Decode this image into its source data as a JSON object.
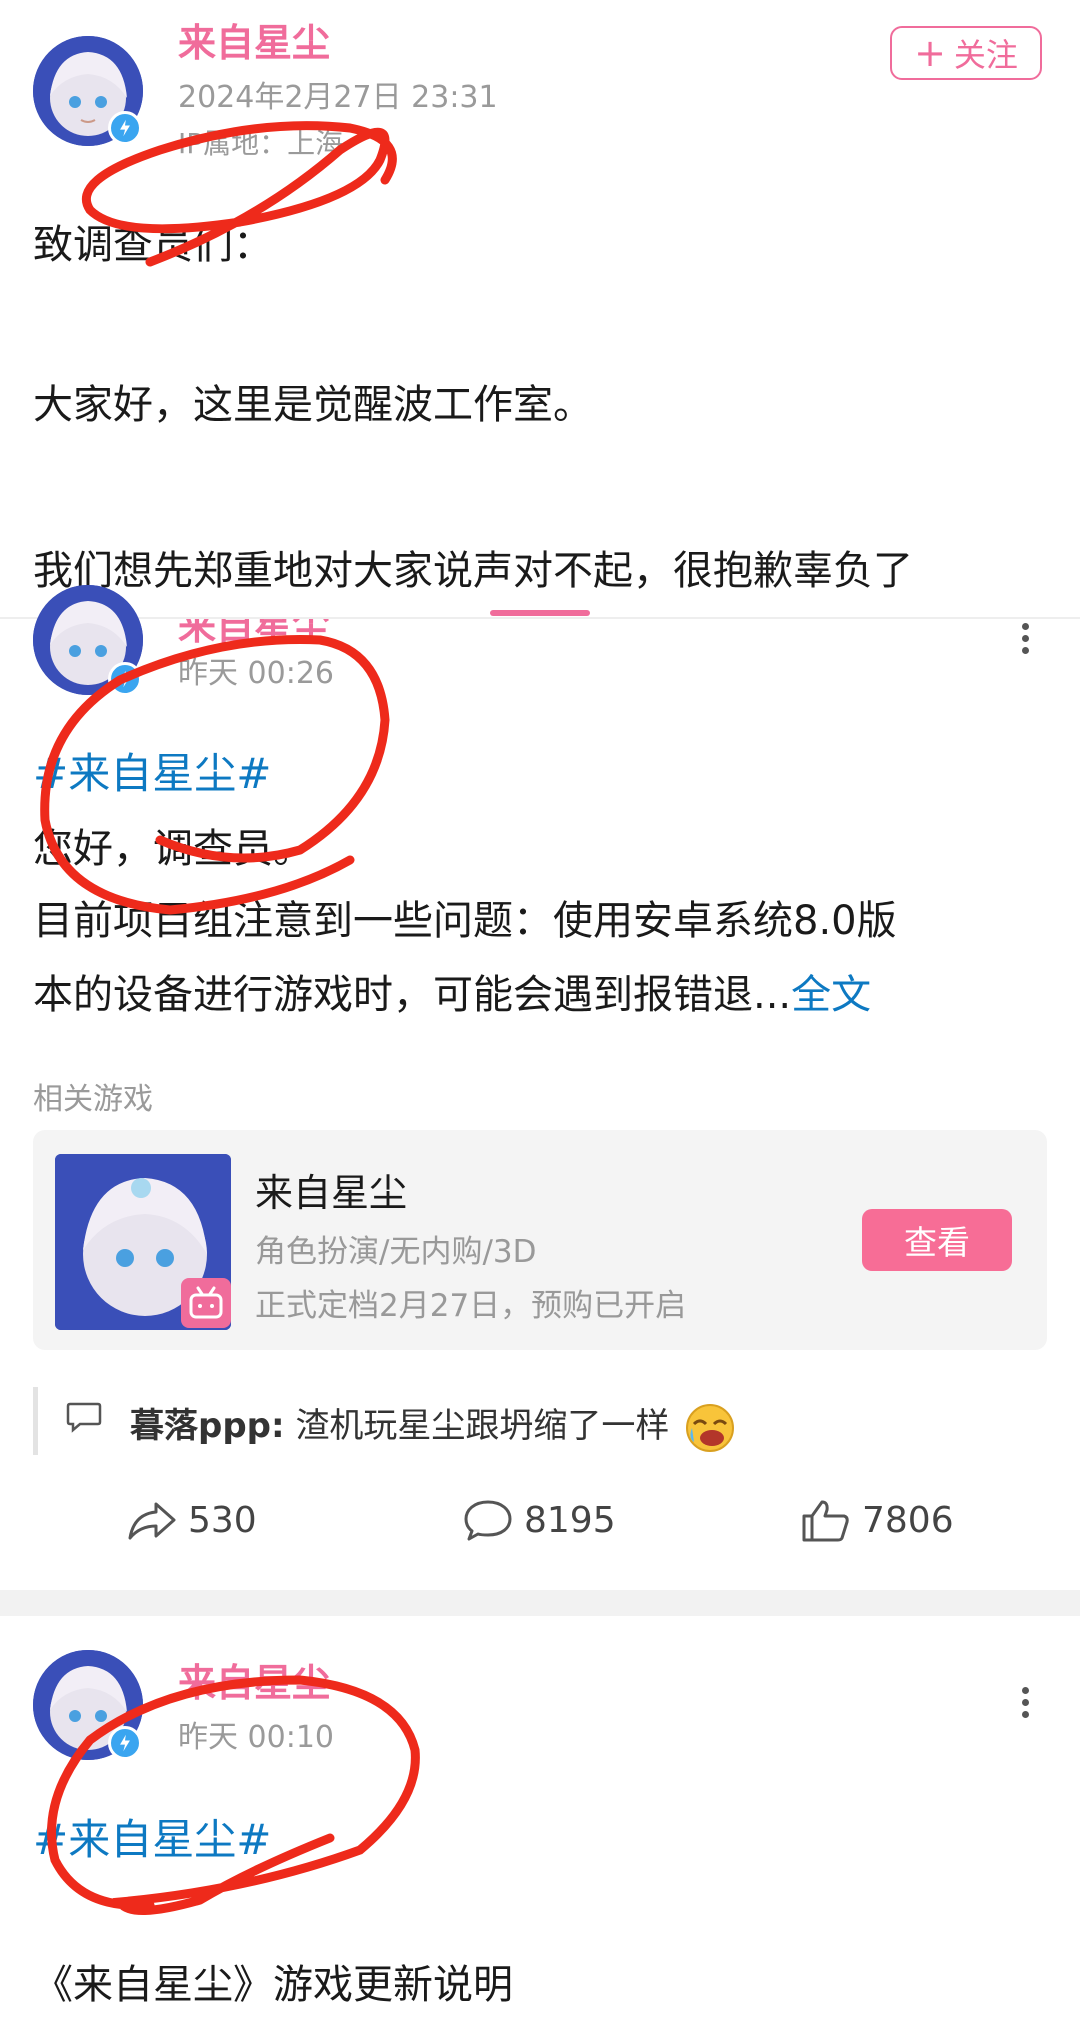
{
  "post1": {
    "author": "来自星尘",
    "datetime": "2024年2月27日 23:31",
    "ip_location": "IP属地：上海",
    "follow_label": "关注",
    "lines": [
      "致调查员们：",
      "大家好，这里是觉醒波工作室。",
      "我们想先郑重地对大家说声对不起，很抱歉辜负了"
    ]
  },
  "post2": {
    "author": "来自星尘",
    "datetime": "昨天 00:26",
    "topic": "#来自星尘#",
    "lines": [
      "您好，调查员。",
      "目前项目组注意到一些问题：使用安卓系统8.0版",
      "本的设备进行游戏时，可能会遇到报错退..."
    ],
    "more_label": "全文",
    "related_label": "相关游戏",
    "game": {
      "title": "来自星尘",
      "tags": "角色扮演/无内购/3D",
      "date": "正式定档2月27日，预购已开启",
      "button": "查看"
    },
    "comment": {
      "user": "暮落ppp:",
      "text": "渣机玩星尘跟坍缩了一样"
    },
    "stats": {
      "shares": "530",
      "comments": "8195",
      "likes": "7806"
    }
  },
  "post3": {
    "author": "来自星尘",
    "datetime": "昨天 00:10",
    "topic": "#来自星尘#",
    "title": "《来自星尘》游戏更新说明"
  },
  "colors": {
    "accent": "#f06c9b",
    "topic": "#0d79c2",
    "annotation": "#ee2a1b"
  },
  "icons": [
    "verified-icon",
    "more-icon",
    "share-icon",
    "comment-icon",
    "like-icon",
    "chat-bubble-icon",
    "bilibili-icon"
  ]
}
